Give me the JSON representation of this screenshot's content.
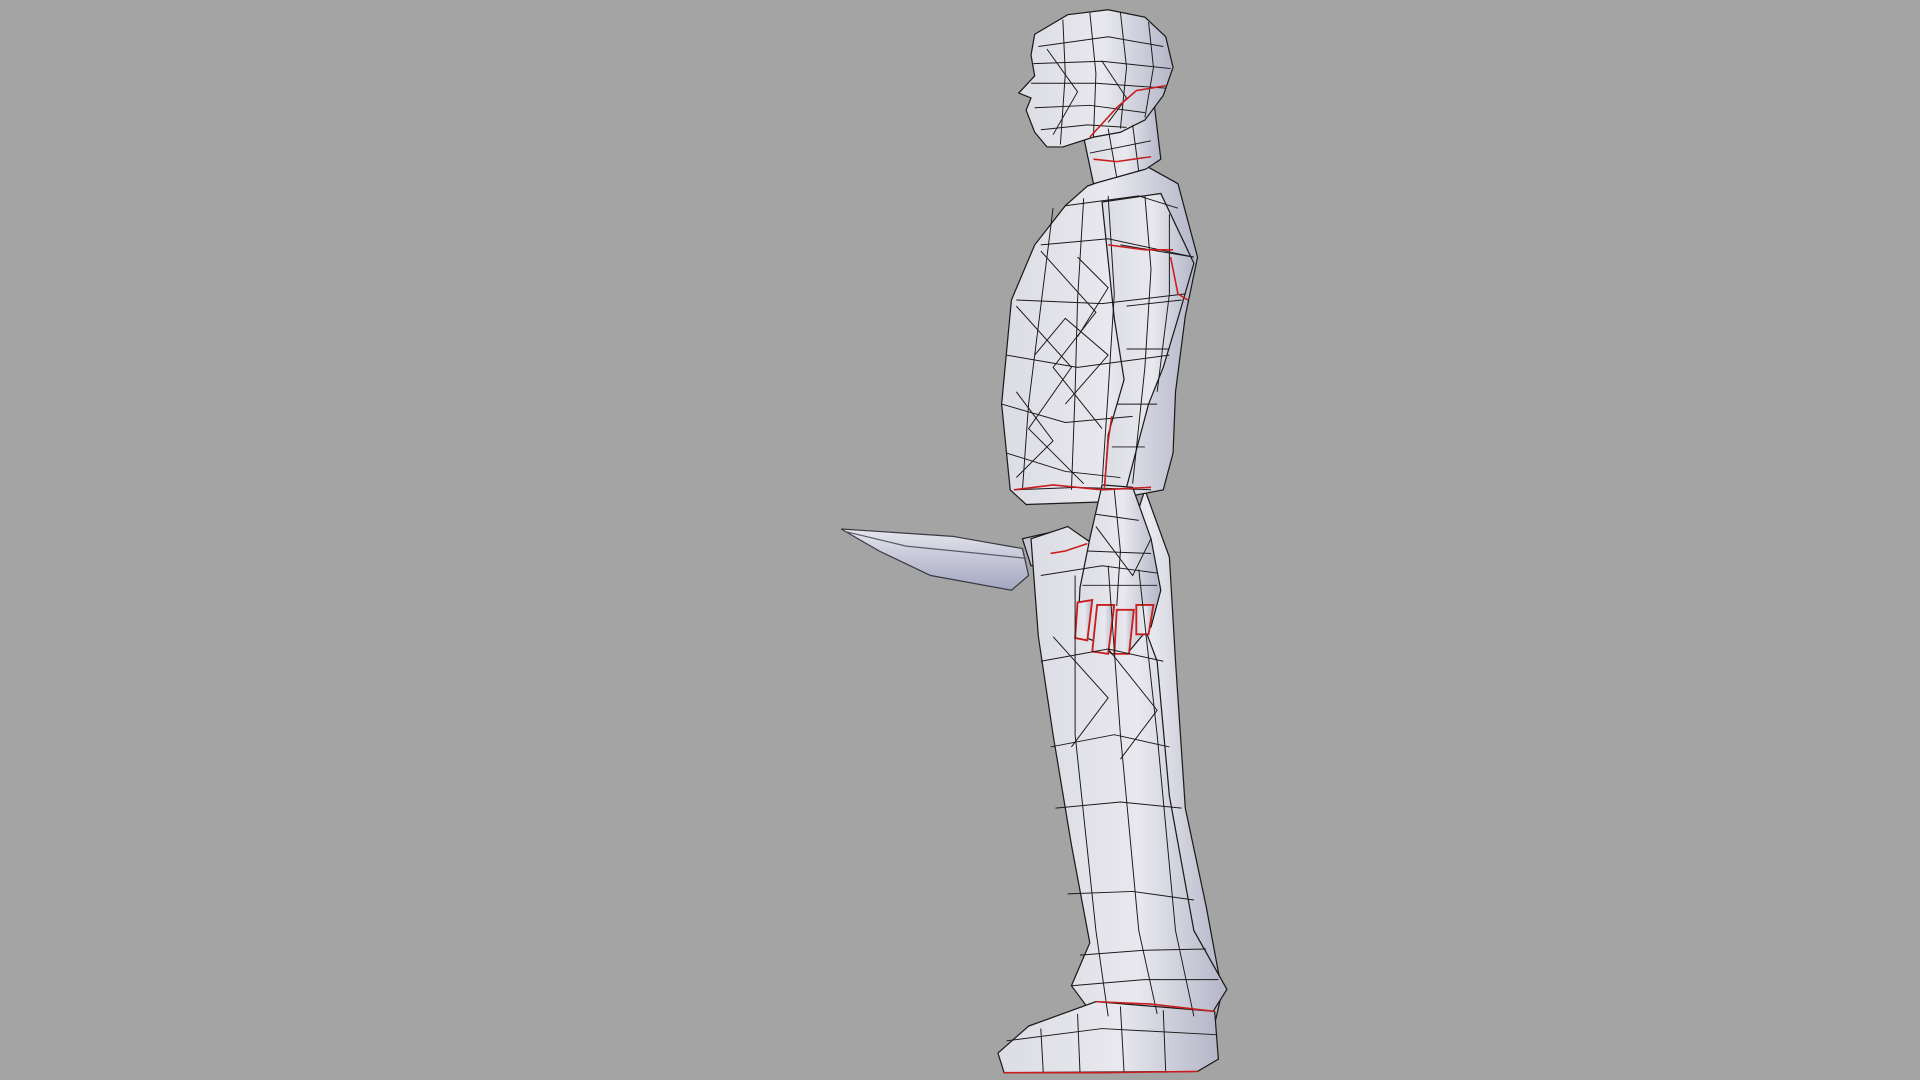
{
  "viewport": {
    "background_color": "#a4a4a4"
  },
  "model": {
    "kind": "low-poly human figure holding a knife, side view, wireframe overlay",
    "mesh_fill": "#dcdce4",
    "mesh_shadow": "#b4b6c8",
    "wire_color": "#1a1a1a",
    "seam_color": "#c81e1e",
    "blade_fill": "#e6e6ee",
    "blade_shadow": "#a2a6c0"
  }
}
